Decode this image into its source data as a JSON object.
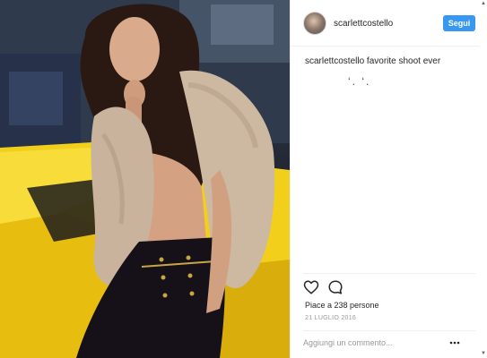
{
  "post": {
    "image_alt": "Woman in fur vest leaning on a yellow car"
  },
  "header": {
    "username": "scarlettcostello",
    "follow_label": "Segui"
  },
  "caption": {
    "text": "scarlettcostello favorite shoot ever",
    "emoji": "‘. ‘."
  },
  "actions": {
    "like_icon": "heart-icon",
    "comment_icon": "comment-bubble-icon"
  },
  "likes": {
    "text": "Piace a 238 persone"
  },
  "date": {
    "text": "21 LUGLIO 2016"
  },
  "comment": {
    "placeholder": "Aggiungi un commento...",
    "more_icon": "more-options-icon"
  },
  "colors": {
    "follow_button": "#3897f0",
    "divider": "#efefef",
    "muted_text": "#999999",
    "car_yellow": "#f2cf1a"
  }
}
